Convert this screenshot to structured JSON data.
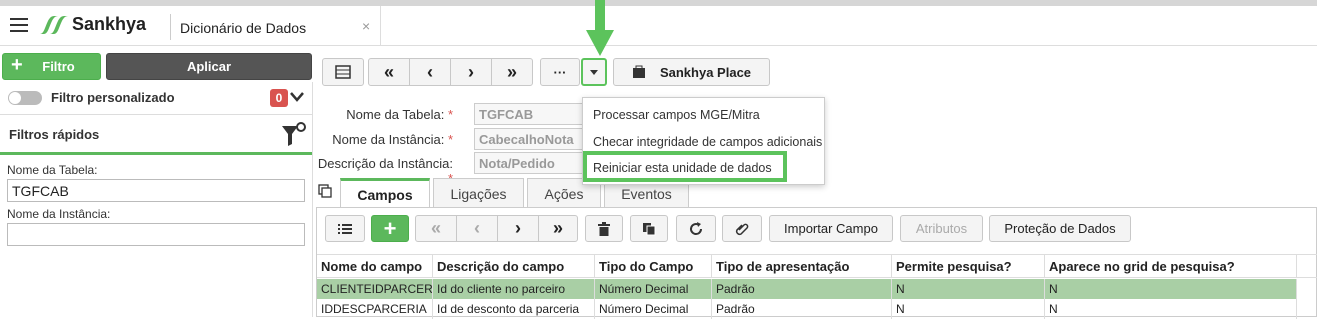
{
  "app": {
    "brand": "Sankhya",
    "tab_title": "Dicionário de Dados",
    "tab_close": "×"
  },
  "left": {
    "filter_button": "Filtro",
    "apply_button": "Aplicar",
    "custom_filter_label": "Filtro personalizado",
    "custom_filter_count": "0",
    "quick_filters_title": "Filtros rápidos",
    "table_name_label": "Nome da Tabela:",
    "table_name_value": "TGFCAB",
    "instance_name_label": "Nome da Instância:",
    "instance_name_value": ""
  },
  "toolbar": {
    "more_label": "···",
    "sankhya_place_label": "Sankhya Place"
  },
  "form": {
    "table_label": "Nome da Tabela:",
    "table_value": "TGFCAB",
    "instance_label": "Nome da Instância:",
    "instance_value": "CabecalhoNota",
    "description_label": "Descrição da Instância:",
    "description_value": "Nota/Pedido",
    "required_mark": "*"
  },
  "dropdown": {
    "items": [
      "Processar campos MGE/Mitra",
      "Checar integridade de campos adicionais",
      "Reiniciar esta unidade de dados"
    ]
  },
  "tabs": [
    "Campos",
    "Ligações",
    "Ações",
    "Eventos"
  ],
  "grid_toolbar": {
    "import_label": "Importar Campo",
    "attributes_label": "Atributos",
    "protection_label": "Proteção de Dados"
  },
  "table": {
    "columns": [
      "Nome do campo",
      "Descrição do campo",
      "Tipo do Campo",
      "Tipo de apresentação",
      "Permite pesquisa?",
      "Aparece no grid de pesquisa?"
    ],
    "rows": [
      [
        "CLIENTEIDPARCER",
        "Id do cliente no parceiro",
        "Número Decimal",
        "Padrão",
        "N",
        "N"
      ],
      [
        "IDDESCPARCERIA",
        "Id de desconto da parceria",
        "Número Decimal",
        "Padrão",
        "N",
        "N"
      ]
    ]
  },
  "colors": {
    "accent_green": "#5cb85c",
    "highlight_green": "#5cc35c",
    "selected_row": "#a9cfa5",
    "badge_red": "#d9534f"
  },
  "icons": [
    "menu-icon",
    "sankhya-logo-icon",
    "grid-view-icon",
    "first-icon",
    "previous-icon",
    "next-icon",
    "last-icon",
    "more-icon",
    "caret-down-icon",
    "bag-icon",
    "filter-icon",
    "copy-icon",
    "list-icon",
    "add-icon",
    "delete-icon",
    "clone-icon",
    "refresh-icon",
    "attachment-icon"
  ]
}
